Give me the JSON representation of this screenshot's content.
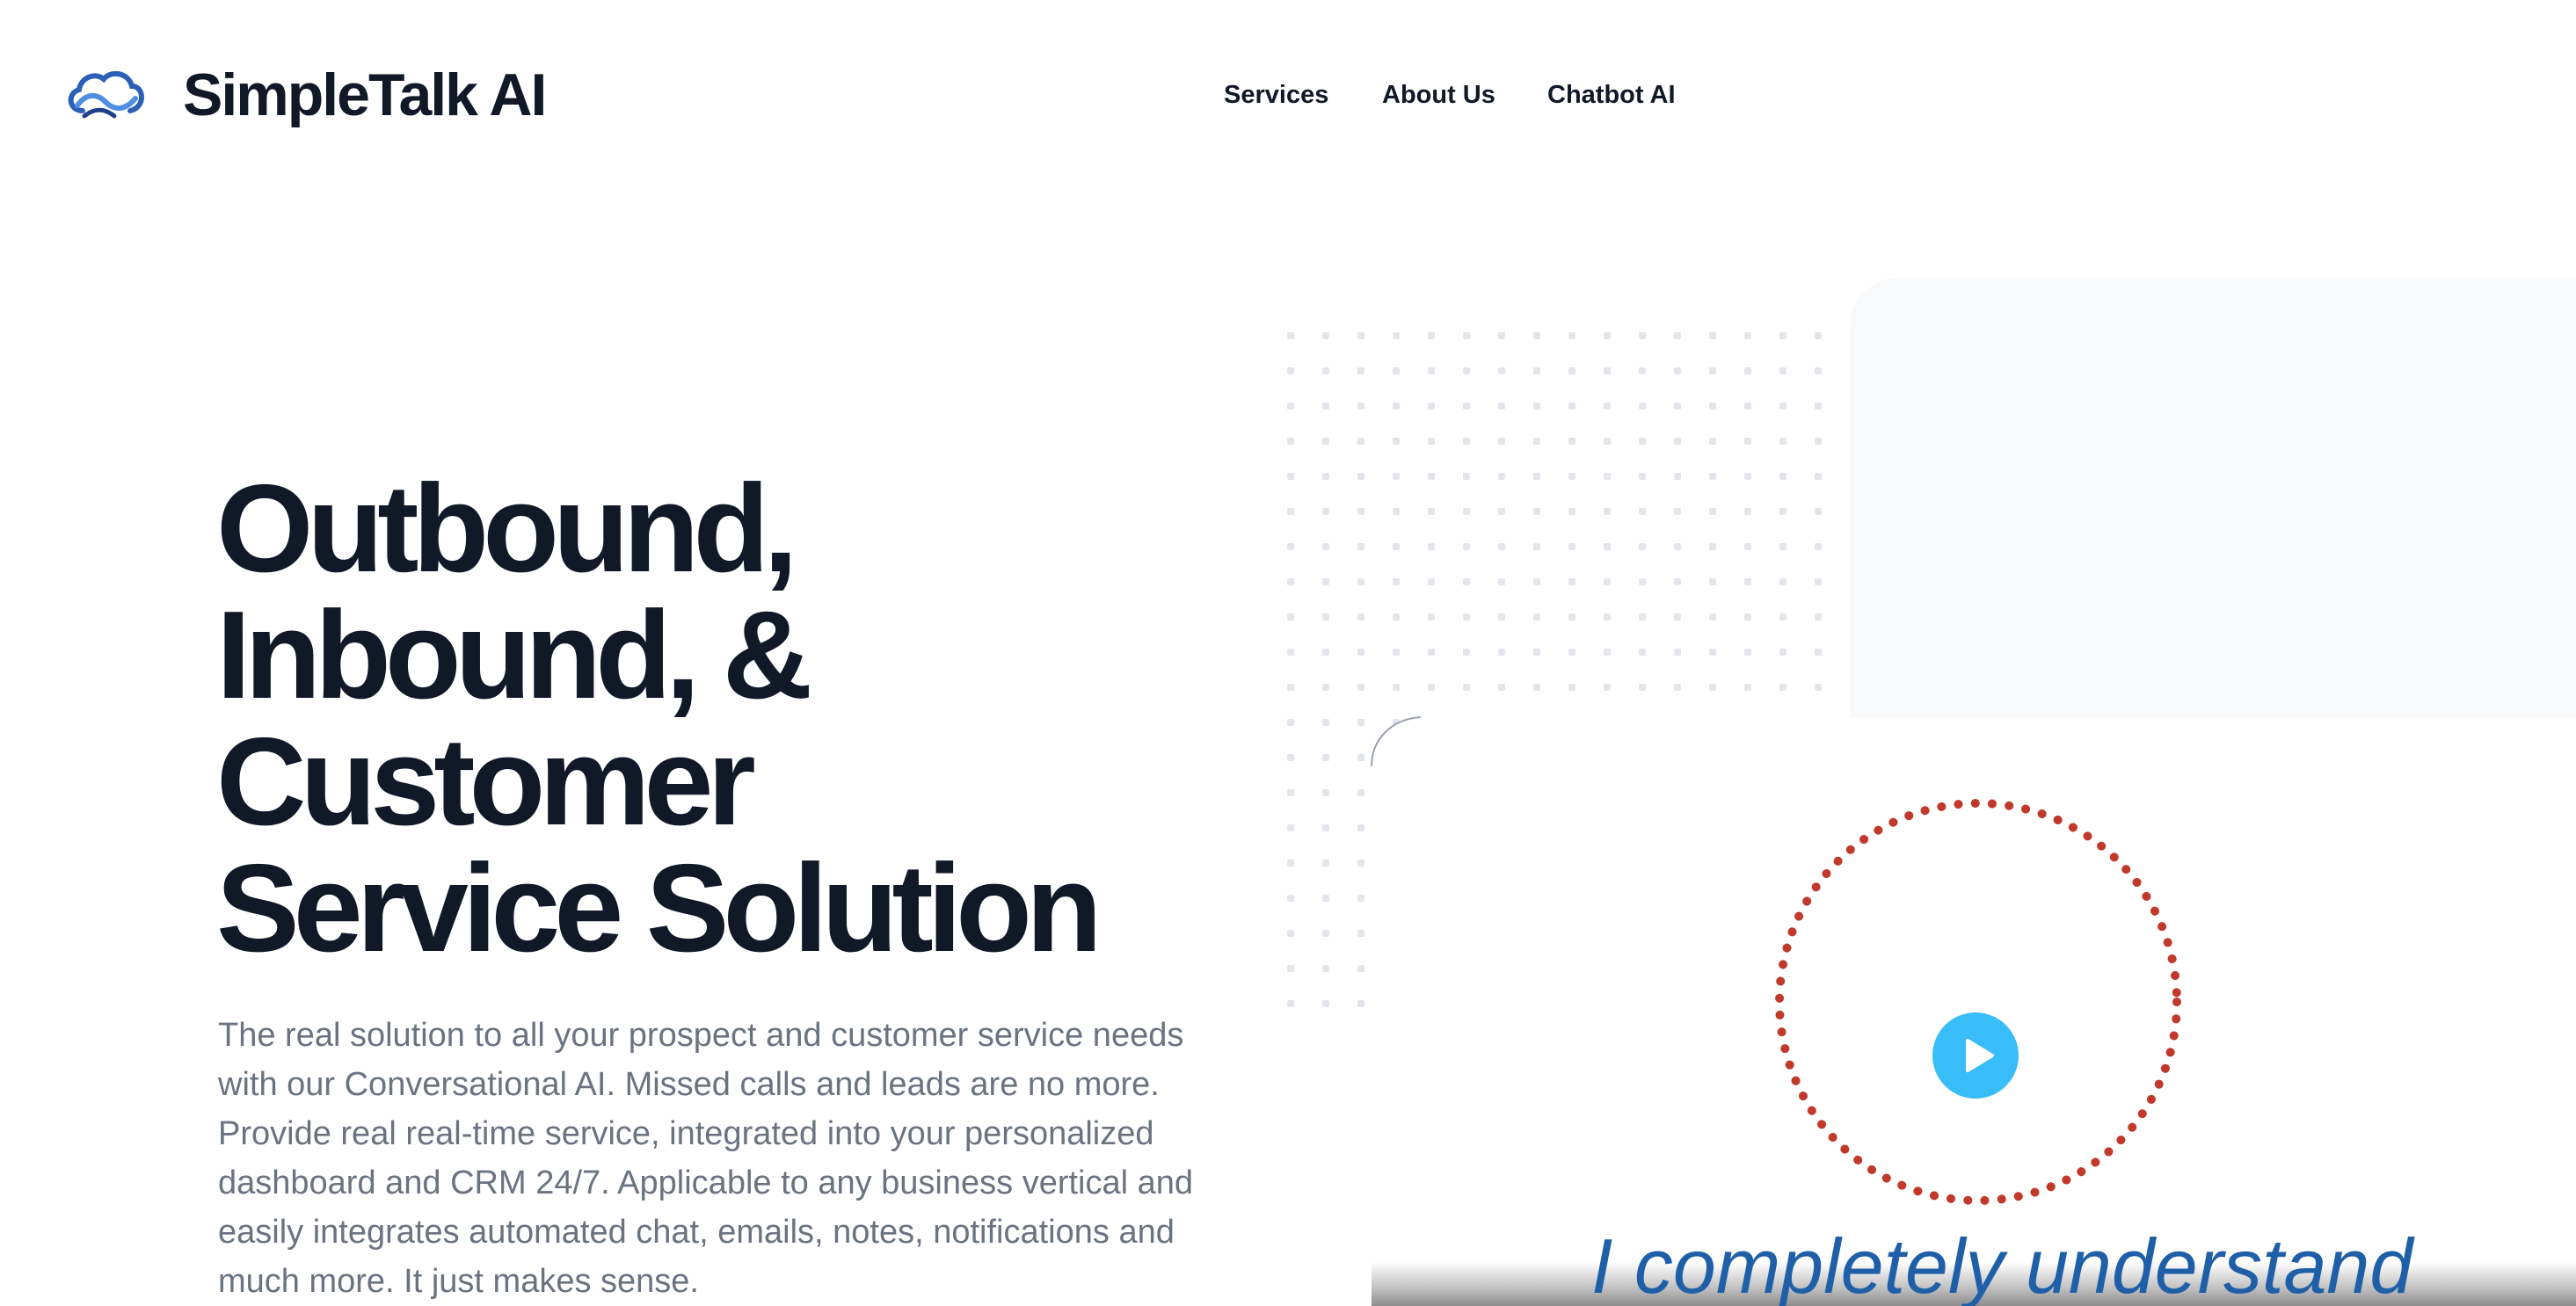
{
  "header": {
    "brand": "SimpleTalk AI",
    "logo_icon": "cloud-wave-icon",
    "nav": [
      {
        "label": "Services"
      },
      {
        "label": "About Us"
      },
      {
        "label": "Chatbot AI"
      }
    ]
  },
  "hero": {
    "title_lines": [
      "Outbound,",
      "Inbound, &",
      "Customer",
      "Service Solution"
    ],
    "description": "The real solution to all your prospect and customer service needs with our Conversational AI. Missed calls and leads are no more. Provide real real-time service, integrated into your personalized dashboard and CRM 24/7. Applicable to any business vertical and easily integrates automated chat, emails, notes, notifications and much more. It just makes sense."
  },
  "video": {
    "caption": "I completely understand",
    "play_icon": "play-icon"
  },
  "colors": {
    "heading": "#111827",
    "body_text": "#6b7280",
    "accent_blue": "#38bdf8",
    "ring_red": "#c0392b",
    "logo_blue": "#2b5fb8",
    "panel_gray": "#f8f9fb",
    "caption_blue": "#1f5fa8"
  }
}
